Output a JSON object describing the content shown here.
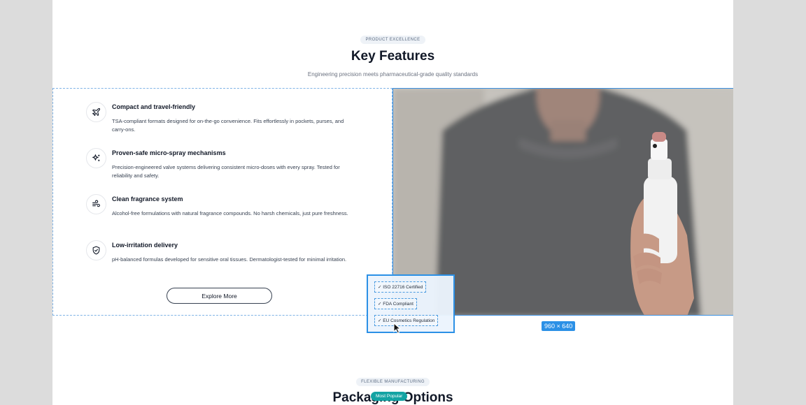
{
  "features_section": {
    "eyebrow": "PRODUCT EXCELLENCE",
    "title": "Key Features",
    "subtitle": "Engineering precision meets pharmaceutical-grade quality standards"
  },
  "features": [
    {
      "icon": "plane-icon",
      "title": "Compact and travel-friendly",
      "description": "TSA-compliant formats designed for on-the-go convenience. Fits effortlessly in pockets, purses, and carry-ons."
    },
    {
      "icon": "sparkles-icon",
      "title": "Proven-safe micro-spray mechanisms",
      "description": "Precision-engineered valve systems delivering consistent micro-doses with every spray. Tested for reliability and safety."
    },
    {
      "icon": "wind-icon",
      "title": "Clean fragrance system",
      "description": "Alcohol-free formulations with natural fragrance compounds. No harsh chemicals, just pure freshness."
    },
    {
      "icon": "shield-check-icon",
      "title": "Low-irritation delivery",
      "description": "pH-balanced formulas developed for sensitive oral tissues. Dermatologist-tested for minimal irritation."
    }
  ],
  "explore_button": "Explore More",
  "image_dimensions": "960 × 640",
  "certifications": [
    "✓ ISO 22716 Certified",
    "✓ FDA Compliant",
    "✓ EU Cosmetics Regulation"
  ],
  "packaging_section": {
    "eyebrow": "FLEXIBLE MANUFACTURING",
    "title": "Packaging Options",
    "badge": "Most Popular"
  },
  "colors": {
    "accent": "#2b90e6",
    "teal": "#13a3a3",
    "text": "#111827"
  }
}
